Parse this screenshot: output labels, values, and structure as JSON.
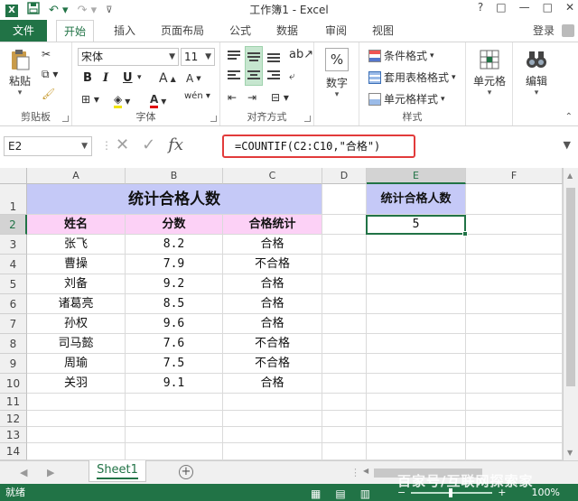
{
  "window": {
    "title": "工作簿1 - Excel",
    "controls": [
      "?",
      "□",
      "—",
      "□",
      "✕"
    ]
  },
  "ribbon": {
    "file_tab": "文件",
    "tabs": [
      "开始",
      "插入",
      "页面布局",
      "公式",
      "数据",
      "审阅",
      "视图"
    ],
    "active_tab": "开始",
    "login": "登录",
    "clipboard": {
      "paste": "粘贴",
      "label": "剪贴板"
    },
    "font": {
      "name": "宋体",
      "size": "11",
      "label": "字体",
      "bold": "B",
      "italic": "I",
      "underline": "U"
    },
    "alignment": {
      "label": "对齐方式"
    },
    "number": {
      "label": "数字",
      "percent": "%"
    },
    "styles": {
      "label": "样式",
      "conditional": "条件格式",
      "table": "套用表格格式",
      "cell": "单元格样式"
    },
    "cells": {
      "label": "单元格"
    },
    "editing": {
      "label": "编辑"
    }
  },
  "formula_bar": {
    "name_box": "E2",
    "formula": "=COUNTIF(C2:C10,\"合格\")",
    "fx": "fx"
  },
  "grid": {
    "columns": [
      "A",
      "B",
      "C",
      "D",
      "E",
      "F"
    ],
    "rows": [
      "1",
      "2",
      "3",
      "4",
      "5",
      "6",
      "7",
      "8",
      "9",
      "10",
      "11",
      "12",
      "13",
      "14"
    ],
    "title": "统计合格人数",
    "headers": [
      "姓名",
      "分数",
      "合格统计"
    ],
    "data": [
      [
        "张飞",
        "8.2",
        "合格"
      ],
      [
        "曹操",
        "7.9",
        "不合格"
      ],
      [
        "刘备",
        "9.2",
        "合格"
      ],
      [
        "诸葛亮",
        "8.5",
        "合格"
      ],
      [
        "孙权",
        "9.6",
        "合格"
      ],
      [
        "司马懿",
        "7.6",
        "不合格"
      ],
      [
        "周瑜",
        "7.5",
        "不合格"
      ],
      [
        "关羽",
        "9.1",
        "合格"
      ]
    ],
    "e1": "统计合格人数",
    "e2": "5"
  },
  "sheets": {
    "active": "Sheet1",
    "add": "+"
  },
  "status": {
    "ready": "就绪",
    "zoom": "100%"
  },
  "watermark": "百家号/互联网探索家"
}
